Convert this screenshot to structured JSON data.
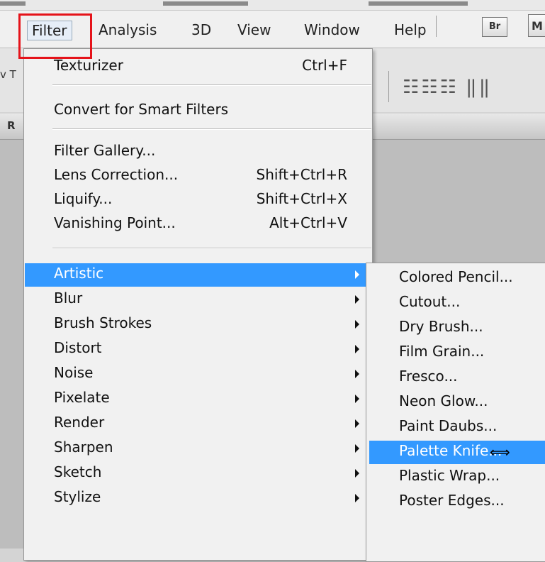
{
  "menubar": {
    "items": [
      {
        "label": "Filter"
      },
      {
        "label": "Analysis"
      },
      {
        "label": "3D"
      },
      {
        "label": "View"
      },
      {
        "label": "Window"
      },
      {
        "label": "Help"
      }
    ],
    "bridge_label": "Br",
    "mini_label": "M"
  },
  "optionsbar": {
    "tool_label": "v T"
  },
  "document": {
    "tab_label": "R"
  },
  "filter_menu": {
    "last_filter": {
      "label": "Texturizer",
      "shortcut": "Ctrl+F"
    },
    "smart": {
      "label": "Convert for Smart Filters"
    },
    "special": [
      {
        "label": "Filter Gallery...",
        "shortcut": ""
      },
      {
        "label": "Lens Correction...",
        "shortcut": "Shift+Ctrl+R"
      },
      {
        "label": "Liquify...",
        "shortcut": "Shift+Ctrl+X"
      },
      {
        "label": "Vanishing Point...",
        "shortcut": "Alt+Ctrl+V"
      }
    ],
    "groups": [
      {
        "label": "Artistic"
      },
      {
        "label": "Blur"
      },
      {
        "label": "Brush Strokes"
      },
      {
        "label": "Distort"
      },
      {
        "label": "Noise"
      },
      {
        "label": "Pixelate"
      },
      {
        "label": "Render"
      },
      {
        "label": "Sharpen"
      },
      {
        "label": "Sketch"
      },
      {
        "label": "Stylize"
      }
    ],
    "selected_group": "Artistic"
  },
  "artistic_submenu": {
    "items": [
      {
        "label": "Colored Pencil..."
      },
      {
        "label": "Cutout..."
      },
      {
        "label": "Dry Brush..."
      },
      {
        "label": "Film Grain..."
      },
      {
        "label": "Fresco..."
      },
      {
        "label": "Neon Glow..."
      },
      {
        "label": "Paint Daubs..."
      },
      {
        "label": "Palette Knife..."
      },
      {
        "label": "Plastic Wrap..."
      },
      {
        "label": "Poster Edges..."
      }
    ],
    "selected_item": "Palette Knife..."
  },
  "colors": {
    "selection": "#3399ff",
    "highlight_box": "#e5131a"
  }
}
